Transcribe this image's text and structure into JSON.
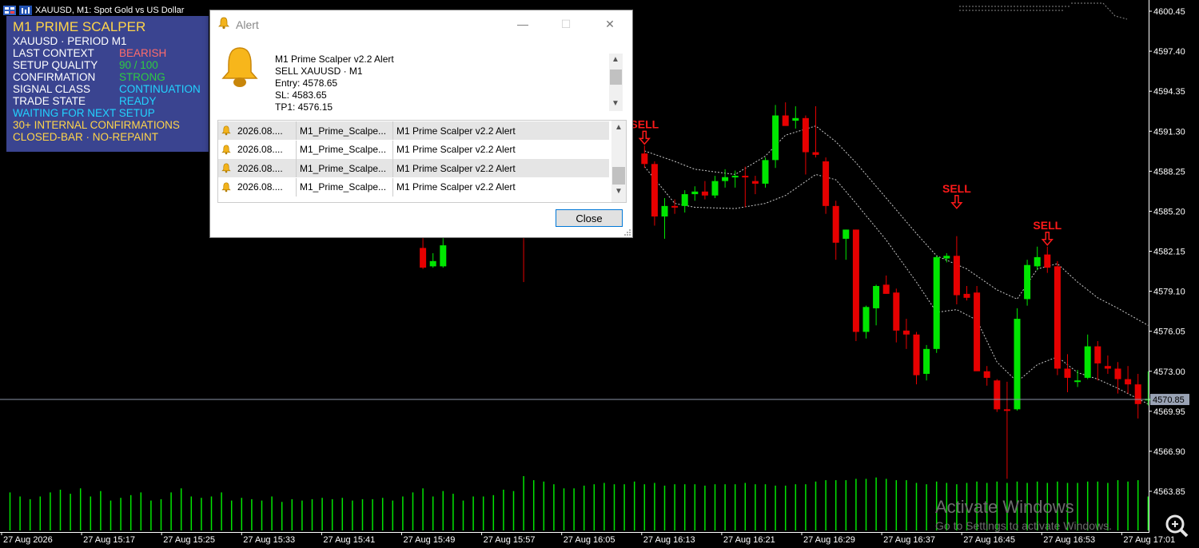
{
  "chart_window": {
    "title": "XAUUSD, M1:  Spot Gold vs US Dollar",
    "icon_names": [
      "chart-window-icon",
      "indicator-icon"
    ]
  },
  "indicator_panel": {
    "title": "M1 PRIME SCALPER",
    "lines": [
      {
        "label": "XAUUSD · PERIOD M1",
        "value": "",
        "label_color": "#ffffff",
        "value_color": "#ffffff"
      },
      {
        "label": "LAST CONTEXT",
        "value": "BEARISH",
        "label_color": "#ffffff",
        "value_color": "#ff6b6b"
      },
      {
        "label": "SETUP QUALITY",
        "value": "90 / 100",
        "label_color": "#ffffff",
        "value_color": "#2ecc40"
      },
      {
        "label": "CONFIRMATION",
        "value": "STRONG",
        "label_color": "#ffffff",
        "value_color": "#2ecc40"
      },
      {
        "label": "SIGNAL CLASS",
        "value": "CONTINUATION",
        "label_color": "#ffffff",
        "value_color": "#22d3ff"
      },
      {
        "label": "TRADE STATE",
        "value": "READY",
        "label_color": "#ffffff",
        "value_color": "#22d3ff"
      },
      {
        "label": "WAITING FOR NEXT SETUP",
        "value": "",
        "label_color": "#22d3ff",
        "value_color": ""
      },
      {
        "label": "30+ INTERNAL CONFIRMATIONS",
        "value": "",
        "label_color": "#ffd54a",
        "value_color": ""
      },
      {
        "label": "CLOSED-BAR · NO-REPAINT",
        "value": "",
        "label_color": "#ffd54a",
        "value_color": ""
      }
    ],
    "background": "#3a4490"
  },
  "alert_dialog": {
    "title": "Alert",
    "message_lines": [
      "M1 Prime Scalper v2.2 Alert",
      "SELL XAUUSD · M1",
      "Entry: 4578.65",
      "SL: 4583.65",
      "TP1: 4576.15"
    ],
    "list_rows": [
      {
        "time": "2026.08....",
        "source": "M1_Prime_Scalpe...",
        "message": "M1 Prime Scalper v2.2 Alert"
      },
      {
        "time": "2026.08....",
        "source": "M1_Prime_Scalpe...",
        "message": "M1 Prime Scalper v2.2 Alert"
      },
      {
        "time": "2026.08....",
        "source": "M1_Prime_Scalpe...",
        "message": "M1 Prime Scalper v2.2 Alert"
      },
      {
        "time": "2026.08....",
        "source": "M1_Prime_Scalpe...",
        "message": "M1 Prime Scalper v2.2 Alert"
      }
    ],
    "close_label": "Close",
    "window_buttons": {
      "minimize": "—",
      "maximize": "☐",
      "close": "✕"
    }
  },
  "watermark": {
    "line1": "Activate Windows",
    "line2": "Go to Settings to activate Windows."
  },
  "chart_data": {
    "type": "candlestick",
    "symbol": "XAUUSD",
    "timeframe": "M1",
    "y_ticks": [
      "4600.45",
      "4597.40",
      "4594.35",
      "4591.30",
      "4588.25",
      "4585.20",
      "4582.15",
      "4579.10",
      "4576.05",
      "4573.00",
      "4569.95",
      "4566.90",
      "4563.85"
    ],
    "ylim": [
      4562.5,
      4601.5
    ],
    "current_price": "4570.85",
    "x_tick_labels": [
      "27 Aug 2026",
      "27 Aug 15:17",
      "27 Aug 15:25",
      "27 Aug 15:33",
      "27 Aug 15:41",
      "27 Aug 15:49",
      "27 Aug 15:57",
      "27 Aug 16:05",
      "27 Aug 16:13",
      "27 Aug 16:21",
      "27 Aug 16:29",
      "27 Aug 16:37",
      "27 Aug 16:45",
      "27 Aug 16:53",
      "27 Aug 17:01"
    ],
    "signals": [
      {
        "label": "SELL",
        "bar": 63,
        "price": 4590.2
      },
      {
        "label": "SELL",
        "bar": 94,
        "price": 4585.3
      },
      {
        "label": "SELL",
        "bar": 103,
        "price": 4582.5
      }
    ],
    "candles": [
      {
        "i": 41,
        "o": 4582.4,
        "h": 4584.5,
        "l": 4580.8,
        "c": 4580.9,
        "up": false
      },
      {
        "i": 42,
        "o": 4581.0,
        "h": 4582.0,
        "l": 4580.9,
        "c": 4581.4,
        "up": true
      },
      {
        "i": 43,
        "o": 4581.0,
        "h": 4583.5,
        "l": 4580.9,
        "c": 4582.6,
        "up": true
      },
      {
        "i": 51,
        "o": 4583.5,
        "h": 4585.0,
        "l": 4579.8,
        "c": 4583.5,
        "up": false
      },
      {
        "i": 63,
        "o": 4589.6,
        "h": 4590.2,
        "l": 4588.5,
        "c": 4588.8,
        "up": false
      },
      {
        "i": 64,
        "o": 4588.8,
        "h": 4589.0,
        "l": 4584.1,
        "c": 4584.8,
        "up": false
      },
      {
        "i": 65,
        "o": 4584.8,
        "h": 4586.2,
        "l": 4583.1,
        "c": 4585.6,
        "up": true
      },
      {
        "i": 66,
        "o": 4585.5,
        "h": 4586.1,
        "l": 4585.0,
        "c": 4585.6,
        "up": false
      },
      {
        "i": 67,
        "o": 4585.6,
        "h": 4586.8,
        "l": 4585.1,
        "c": 4586.5,
        "up": true
      },
      {
        "i": 68,
        "o": 4586.5,
        "h": 4587.1,
        "l": 4586.0,
        "c": 4586.7,
        "up": true
      },
      {
        "i": 69,
        "o": 4586.7,
        "h": 4587.5,
        "l": 4586.1,
        "c": 4586.4,
        "up": false
      },
      {
        "i": 70,
        "o": 4586.4,
        "h": 4587.9,
        "l": 4586.2,
        "c": 4587.5,
        "up": true
      },
      {
        "i": 71,
        "o": 4587.5,
        "h": 4588.4,
        "l": 4587.0,
        "c": 4587.8,
        "up": true
      },
      {
        "i": 72,
        "o": 4587.8,
        "h": 4588.3,
        "l": 4587.0,
        "c": 4587.9,
        "up": true
      },
      {
        "i": 73,
        "o": 4587.9,
        "h": 4588.6,
        "l": 4585.5,
        "c": 4587.8,
        "up": false
      },
      {
        "i": 74,
        "o": 4587.5,
        "h": 4587.9,
        "l": 4586.5,
        "c": 4587.3,
        "up": false
      },
      {
        "i": 75,
        "o": 4587.3,
        "h": 4589.3,
        "l": 4587.0,
        "c": 4589.1,
        "up": true
      },
      {
        "i": 76,
        "o": 4589.1,
        "h": 4593.3,
        "l": 4588.5,
        "c": 4592.5,
        "up": true
      },
      {
        "i": 77,
        "o": 4592.5,
        "h": 4593.5,
        "l": 4591.8,
        "c": 4591.7,
        "up": false
      },
      {
        "i": 78,
        "o": 4592.1,
        "h": 4593.2,
        "l": 4591.5,
        "c": 4592.3,
        "up": true
      },
      {
        "i": 79,
        "o": 4592.3,
        "h": 4592.5,
        "l": 4588.0,
        "c": 4589.7,
        "up": false
      },
      {
        "i": 80,
        "o": 4589.5,
        "h": 4593.2,
        "l": 4589.3,
        "c": 4589.7,
        "up": false
      },
      {
        "i": 81,
        "o": 4589.0,
        "h": 4589.3,
        "l": 4585.0,
        "c": 4585.6,
        "up": false
      },
      {
        "i": 82,
        "o": 4585.6,
        "h": 4586.0,
        "l": 4581.5,
        "c": 4582.8,
        "up": false
      },
      {
        "i": 83,
        "o": 4583.1,
        "h": 4583.8,
        "l": 4581.5,
        "c": 4583.8,
        "up": true
      },
      {
        "i": 84,
        "o": 4583.8,
        "h": 4583.8,
        "l": 4575.3,
        "c": 4576.0,
        "up": false
      },
      {
        "i": 85,
        "o": 4576.0,
        "h": 4578.0,
        "l": 4575.5,
        "c": 4577.9,
        "up": true
      },
      {
        "i": 86,
        "o": 4577.8,
        "h": 4579.6,
        "l": 4576.5,
        "c": 4579.5,
        "up": true
      },
      {
        "i": 87,
        "o": 4579.6,
        "h": 4580.3,
        "l": 4578.9,
        "c": 4578.9,
        "up": false
      },
      {
        "i": 88,
        "o": 4579.0,
        "h": 4579.3,
        "l": 4575.2,
        "c": 4576.1,
        "up": false
      },
      {
        "i": 89,
        "o": 4576.1,
        "h": 4577.0,
        "l": 4574.7,
        "c": 4575.8,
        "up": false
      },
      {
        "i": 90,
        "o": 4575.8,
        "h": 4576.0,
        "l": 4572.0,
        "c": 4572.7,
        "up": false
      },
      {
        "i": 91,
        "o": 4572.8,
        "h": 4575.0,
        "l": 4572.3,
        "c": 4574.7,
        "up": true
      },
      {
        "i": 92,
        "o": 4574.7,
        "h": 4581.8,
        "l": 4574.4,
        "c": 4581.7,
        "up": true
      },
      {
        "i": 93,
        "o": 4581.6,
        "h": 4582.0,
        "l": 4581.3,
        "c": 4581.8,
        "up": true
      },
      {
        "i": 94,
        "o": 4581.8,
        "h": 4583.3,
        "l": 4578.1,
        "c": 4578.8,
        "up": false
      },
      {
        "i": 95,
        "o": 4578.9,
        "h": 4579.5,
        "l": 4578.4,
        "c": 4578.6,
        "up": false
      },
      {
        "i": 96,
        "o": 4579.0,
        "h": 4579.5,
        "l": 4573.6,
        "c": 4573.0,
        "up": false
      },
      {
        "i": 97,
        "o": 4573.0,
        "h": 4573.4,
        "l": 4571.9,
        "c": 4572.5,
        "up": false
      },
      {
        "i": 98,
        "o": 4572.3,
        "h": 4572.4,
        "l": 4569.9,
        "c": 4570.1,
        "up": false
      },
      {
        "i": 99,
        "o": 4570.1,
        "h": 4572.2,
        "l": 4564.8,
        "c": 4570.0,
        "up": false
      },
      {
        "i": 100,
        "o": 4570.1,
        "h": 4577.8,
        "l": 4570.0,
        "c": 4577.0,
        "up": true
      },
      {
        "i": 101,
        "o": 4578.5,
        "h": 4581.5,
        "l": 4578.0,
        "c": 4581.1,
        "up": true
      },
      {
        "i": 102,
        "o": 4581.0,
        "h": 4582.5,
        "l": 4580.7,
        "c": 4581.7,
        "up": true
      },
      {
        "i": 103,
        "o": 4581.9,
        "h": 4582.5,
        "l": 4580.5,
        "c": 4580.9,
        "up": false
      },
      {
        "i": 104,
        "o": 4581.0,
        "h": 4581.4,
        "l": 4572.7,
        "c": 4573.2,
        "up": false
      },
      {
        "i": 105,
        "o": 4573.2,
        "h": 4574.3,
        "l": 4571.4,
        "c": 4572.5,
        "up": false
      },
      {
        "i": 106,
        "o": 4572.3,
        "h": 4573.1,
        "l": 4571.8,
        "c": 4572.3,
        "up": true
      },
      {
        "i": 107,
        "o": 4572.5,
        "h": 4575.8,
        "l": 4572.4,
        "c": 4574.9,
        "up": true
      },
      {
        "i": 108,
        "o": 4574.9,
        "h": 4575.3,
        "l": 4572.3,
        "c": 4573.6,
        "up": false
      },
      {
        "i": 109,
        "o": 4573.4,
        "h": 4574.2,
        "l": 4572.8,
        "c": 4573.2,
        "up": false
      },
      {
        "i": 110,
        "o": 4573.2,
        "h": 4573.7,
        "l": 4571.3,
        "c": 4572.4,
        "up": false
      },
      {
        "i": 111,
        "o": 4572.4,
        "h": 4573.4,
        "l": 4571.3,
        "c": 4572.0,
        "up": false
      },
      {
        "i": 112,
        "o": 4572.0,
        "h": 4572.8,
        "l": 4569.4,
        "c": 4570.5,
        "up": false
      },
      {
        "i": 113,
        "o": 4570.8,
        "h": 4573.0,
        "l": 4570.4,
        "c": 4570.9,
        "up": true
      }
    ],
    "upper_band_anchor": [
      [
        63,
        4589.8
      ],
      [
        66,
        4589.0
      ],
      [
        68,
        4588.4
      ],
      [
        72,
        4588.0
      ],
      [
        75,
        4589.4
      ],
      [
        77,
        4591.0
      ],
      [
        80,
        4591.7
      ],
      [
        82,
        4590.5
      ],
      [
        84,
        4588.9
      ],
      [
        87,
        4586.2
      ],
      [
        90,
        4583.5
      ],
      [
        92,
        4581.8
      ],
      [
        95,
        4580.8
      ],
      [
        98,
        4579.2
      ],
      [
        100,
        4578.5
      ],
      [
        102,
        4580.8
      ],
      [
        104,
        4581.2
      ],
      [
        106,
        4579.8
      ],
      [
        108,
        4578.6
      ],
      [
        110,
        4577.8
      ],
      [
        113,
        4576.5
      ]
    ],
    "lower_band_anchor": [
      [
        63,
        4588.6
      ],
      [
        66,
        4585.8
      ],
      [
        68,
        4585.5
      ],
      [
        72,
        4585.4
      ],
      [
        75,
        4585.8
      ],
      [
        77,
        4586.4
      ],
      [
        80,
        4588.0
      ],
      [
        82,
        4587.6
      ],
      [
        84,
        4585.8
      ],
      [
        87,
        4583.0
      ],
      [
        90,
        4579.8
      ],
      [
        92,
        4577.5
      ],
      [
        94,
        4577.7
      ],
      [
        96,
        4576.9
      ],
      [
        98,
        4573.7
      ],
      [
        100,
        4572.2
      ],
      [
        102,
        4573.5
      ],
      [
        104,
        4574.1
      ],
      [
        106,
        4572.9
      ],
      [
        108,
        4572.4
      ],
      [
        110,
        4571.7
      ],
      [
        113,
        4570.5
      ]
    ],
    "volume_bars": [
      {
        "i": 0,
        "v": 28
      },
      {
        "i": 1,
        "v": 25
      },
      {
        "i": 2,
        "v": 23
      },
      {
        "i": 3,
        "v": 25
      },
      {
        "i": 4,
        "v": 28
      },
      {
        "i": 5,
        "v": 30
      },
      {
        "i": 6,
        "v": 27
      },
      {
        "i": 7,
        "v": 31
      },
      {
        "i": 8,
        "v": 25
      },
      {
        "i": 9,
        "v": 29
      },
      {
        "i": 10,
        "v": 22
      },
      {
        "i": 11,
        "v": 24
      },
      {
        "i": 12,
        "v": 26
      },
      {
        "i": 13,
        "v": 28
      },
      {
        "i": 14,
        "v": 22
      },
      {
        "i": 15,
        "v": 23
      },
      {
        "i": 16,
        "v": 28
      },
      {
        "i": 17,
        "v": 31
      },
      {
        "i": 18,
        "v": 25
      },
      {
        "i": 19,
        "v": 24
      },
      {
        "i": 20,
        "v": 25
      },
      {
        "i": 21,
        "v": 28
      },
      {
        "i": 22,
        "v": 22
      },
      {
        "i": 23,
        "v": 24
      },
      {
        "i": 24,
        "v": 23
      },
      {
        "i": 25,
        "v": 22
      },
      {
        "i": 26,
        "v": 25
      },
      {
        "i": 27,
        "v": 21
      },
      {
        "i": 28,
        "v": 23
      },
      {
        "i": 29,
        "v": 22
      },
      {
        "i": 30,
        "v": 23
      },
      {
        "i": 31,
        "v": 24
      },
      {
        "i": 32,
        "v": 23
      },
      {
        "i": 33,
        "v": 24
      },
      {
        "i": 34,
        "v": 22
      },
      {
        "i": 35,
        "v": 23
      },
      {
        "i": 36,
        "v": 23
      },
      {
        "i": 37,
        "v": 24
      },
      {
        "i": 38,
        "v": 22
      },
      {
        "i": 39,
        "v": 25
      },
      {
        "i": 40,
        "v": 28
      },
      {
        "i": 41,
        "v": 31
      },
      {
        "i": 42,
        "v": 25
      },
      {
        "i": 43,
        "v": 29
      },
      {
        "i": 44,
        "v": 27
      },
      {
        "i": 45,
        "v": 22
      },
      {
        "i": 46,
        "v": 25
      },
      {
        "i": 47,
        "v": 25
      },
      {
        "i": 48,
        "v": 26
      },
      {
        "i": 49,
        "v": 30
      },
      {
        "i": 50,
        "v": 29
      },
      {
        "i": 51,
        "v": 40
      },
      {
        "i": 52,
        "v": 37
      },
      {
        "i": 53,
        "v": 36
      },
      {
        "i": 54,
        "v": 34
      },
      {
        "i": 55,
        "v": 31
      },
      {
        "i": 56,
        "v": 31
      },
      {
        "i": 57,
        "v": 33
      },
      {
        "i": 58,
        "v": 34
      },
      {
        "i": 59,
        "v": 35
      },
      {
        "i": 60,
        "v": 34
      },
      {
        "i": 61,
        "v": 34
      },
      {
        "i": 62,
        "v": 36
      },
      {
        "i": 63,
        "v": 34
      },
      {
        "i": 64,
        "v": 35
      },
      {
        "i": 65,
        "v": 33
      },
      {
        "i": 66,
        "v": 34
      },
      {
        "i": 67,
        "v": 34
      },
      {
        "i": 68,
        "v": 34
      },
      {
        "i": 69,
        "v": 33
      },
      {
        "i": 70,
        "v": 34
      },
      {
        "i": 71,
        "v": 34
      },
      {
        "i": 72,
        "v": 34
      },
      {
        "i": 73,
        "v": 35
      },
      {
        "i": 74,
        "v": 34
      },
      {
        "i": 75,
        "v": 34
      },
      {
        "i": 76,
        "v": 33
      },
      {
        "i": 77,
        "v": 33
      },
      {
        "i": 78,
        "v": 34
      },
      {
        "i": 79,
        "v": 34
      },
      {
        "i": 80,
        "v": 36
      },
      {
        "i": 81,
        "v": 37
      },
      {
        "i": 82,
        "v": 37
      },
      {
        "i": 83,
        "v": 37
      },
      {
        "i": 84,
        "v": 38
      },
      {
        "i": 85,
        "v": 38
      },
      {
        "i": 86,
        "v": 39
      },
      {
        "i": 87,
        "v": 38
      },
      {
        "i": 88,
        "v": 37
      },
      {
        "i": 89,
        "v": 37
      },
      {
        "i": 90,
        "v": 35
      },
      {
        "i": 91,
        "v": 34
      },
      {
        "i": 92,
        "v": 36
      },
      {
        "i": 93,
        "v": 35
      },
      {
        "i": 94,
        "v": 34
      },
      {
        "i": 95,
        "v": 35
      },
      {
        "i": 96,
        "v": 36
      },
      {
        "i": 97,
        "v": 35
      },
      {
        "i": 98,
        "v": 36
      },
      {
        "i": 99,
        "v": 35
      },
      {
        "i": 100,
        "v": 36
      },
      {
        "i": 101,
        "v": 35
      },
      {
        "i": 102,
        "v": 36
      },
      {
        "i": 103,
        "v": 35
      },
      {
        "i": 104,
        "v": 36
      },
      {
        "i": 105,
        "v": 35
      },
      {
        "i": 106,
        "v": 35
      },
      {
        "i": 107,
        "v": 36
      },
      {
        "i": 108,
        "v": 36
      },
      {
        "i": 109,
        "v": 35
      },
      {
        "i": 110,
        "v": 37
      },
      {
        "i": 111,
        "v": 36
      },
      {
        "i": 112,
        "v": 37
      },
      {
        "i": 113,
        "v": 25
      }
    ],
    "colors": {
      "up": "#00e600",
      "down": "#e60000",
      "volume": "#00e600",
      "band": "#c8c8c8",
      "signal": "#ff1a1a",
      "axis_text": "#ffffff"
    }
  }
}
